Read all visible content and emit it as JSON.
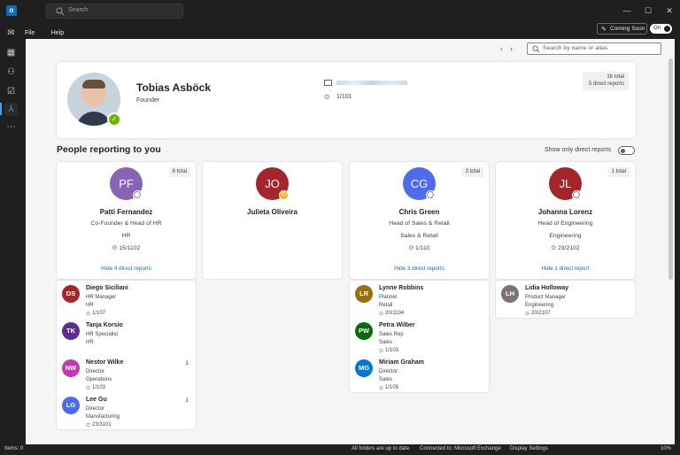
{
  "titlebar": {
    "search_placeholder": "Search"
  },
  "menu": {
    "file": "File",
    "help": "Help"
  },
  "coming_soon": {
    "label": "Coming Soon",
    "toggle": "On"
  },
  "main": {
    "search_placeholder": "Search by name or alias",
    "profile": {
      "name": "Tobias Asböck",
      "title": "Founder",
      "office": "1/101",
      "total": "16 total",
      "direct": "5 direct reports"
    },
    "section_title": "People reporting to you",
    "only_direct_label": "Show only direct reports",
    "reports": [
      {
        "initials": "PF",
        "color": "#8764b8",
        "name": "Patti Fernandez",
        "title": "Co-Founder & Head of HR",
        "dept": "HR",
        "office": "15/1102",
        "total": "6 total",
        "hide": "Hide 4 direct reports",
        "presence": "offline"
      },
      {
        "initials": "JO",
        "color": "#a4262c",
        "name": "Julieta Oliveira",
        "title": "",
        "dept": "",
        "office": "",
        "total": "",
        "hide": "",
        "presence": "away"
      },
      {
        "initials": "CG",
        "color": "#4f6bed",
        "name": "Chris Green",
        "title": "Head of Sales & Retail",
        "dept": "Sales & Retail",
        "office": "1/110",
        "total": "3 total",
        "hide": "Hide 3 direct reports",
        "presence": "offline"
      },
      {
        "initials": "JL",
        "color": "#a4262c",
        "name": "Johanna Lorenz",
        "title": "Head of Engineering",
        "dept": "Engineering",
        "office": "23/2102",
        "total": "1 total",
        "hide": "Hide 1 direct report",
        "presence": "offline"
      }
    ],
    "sublists": [
      [
        {
          "initials": "DS",
          "color": "#a4262c",
          "name": "Diego Siciliani",
          "title": "HR Manager",
          "dept": "HR",
          "office": "1/107",
          "count": ""
        },
        {
          "initials": "TK",
          "color": "#5c2e91",
          "name": "Tanja Korsio",
          "title": "HR Specialist",
          "dept": "HR",
          "office": "",
          "count": ""
        },
        {
          "initials": "NW",
          "color": "#c239b3",
          "name": "Nestor Wilke",
          "title": "Director",
          "dept": "Operations",
          "office": "1/103",
          "count": "1"
        },
        {
          "initials": "LG",
          "color": "#4f6bed",
          "name": "Lee Gu",
          "title": "Director",
          "dept": "Manufacturing",
          "office": "23/3101",
          "count": "1"
        }
      ],
      [
        {
          "initials": "LR",
          "color": "#986f0b",
          "name": "Lynne Robbins",
          "title": "Planner",
          "dept": "Retail",
          "office": "20/1104",
          "count": ""
        },
        {
          "initials": "PW",
          "color": "#0b6a0b",
          "name": "Petra Wilber",
          "title": "Sales Rep",
          "dept": "Sales",
          "office": "1/103",
          "count": ""
        },
        {
          "initials": "MG",
          "color": "#0078d4",
          "name": "Miriam Graham",
          "title": "Director",
          "dept": "Sales",
          "office": "1/105",
          "count": ""
        }
      ],
      [
        {
          "initials": "LH",
          "color": "#7a7574",
          "name": "Lidia Holloway",
          "title": "Product Manager",
          "dept": "Engineering",
          "office": "20/2107",
          "count": ""
        }
      ]
    ]
  },
  "status": {
    "items": "Items: 0",
    "folders": "All folders are up to date.",
    "connected": "Connected to: Microsoft Exchange",
    "display": "Display Settings",
    "zoom": "10%"
  }
}
